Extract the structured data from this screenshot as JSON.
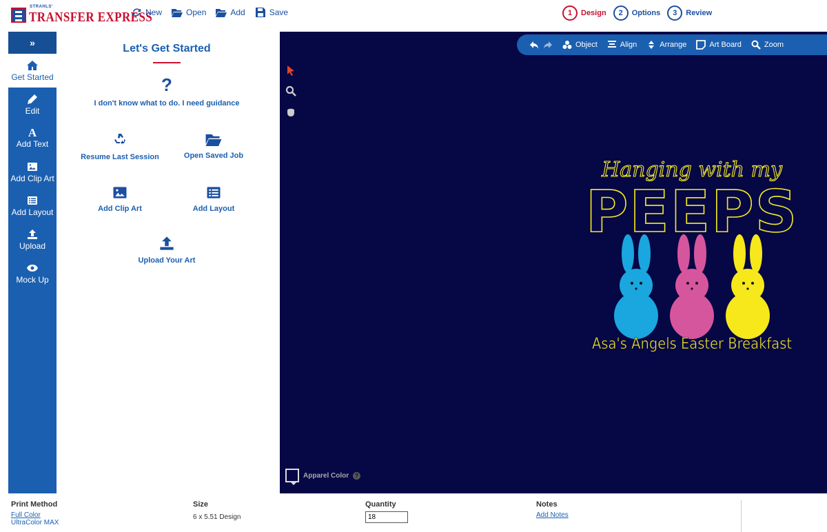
{
  "brand": {
    "strahls": "STRAHLS'",
    "name": "TRANSFER EXPRESS"
  },
  "file_actions": {
    "new": "New",
    "open": "Open",
    "add": "Add",
    "save": "Save"
  },
  "steps": [
    {
      "num": "1",
      "label": "Design"
    },
    {
      "num": "2",
      "label": "Options"
    },
    {
      "num": "3",
      "label": "Review"
    }
  ],
  "sidenav": {
    "collapse": "»",
    "items": [
      {
        "label": "Get Started",
        "icon": "home-icon"
      },
      {
        "label": "Edit",
        "icon": "pencil-icon"
      },
      {
        "label": "Add Text",
        "icon": "text-icon",
        "glyph": "A"
      },
      {
        "label": "Add Clip Art",
        "icon": "image-icon"
      },
      {
        "label": "Add Layout",
        "icon": "layout-icon"
      },
      {
        "label": "Upload",
        "icon": "upload-icon"
      },
      {
        "label": "Mock Up",
        "icon": "eye-icon"
      }
    ]
  },
  "panel": {
    "title": "Let's Get Started",
    "guidance_glyph": "?",
    "guidance": "I don't know what to do. I need guidance",
    "resume": "Resume Last Session",
    "open_saved": "Open Saved Job",
    "clip_art": "Add Clip Art",
    "layout": "Add Layout",
    "upload": "Upload Your Art"
  },
  "canvas_toolbar": {
    "object": "Object",
    "align": "Align",
    "arrange": "Arrange",
    "artboard": "Art Board",
    "zoom": "Zoom"
  },
  "design": {
    "line1": "Hanging with my",
    "line2": "PEEPS",
    "line3": "Asa's Angels Easter Breakfast",
    "colors": {
      "text": "#f4ea20",
      "blue": "#1aa6de",
      "pink": "#d6569e",
      "yellow": "#f6e81a"
    }
  },
  "apparel": {
    "label": "Apparel Color",
    "help": "?"
  },
  "bottom": {
    "print_method": {
      "heading": "Print Method",
      "link": "Full Color",
      "sub": "UltraColor MAX"
    },
    "size": {
      "heading": "Size",
      "value": "6 x 5.51 Design"
    },
    "quantity": {
      "heading": "Quantity",
      "value": "18"
    },
    "notes": {
      "heading": "Notes",
      "link": "Add Notes"
    }
  },
  "colors": {
    "accent": "#1b5fb0",
    "brand_red": "#c8102e",
    "canvas_bg": "#060745"
  }
}
